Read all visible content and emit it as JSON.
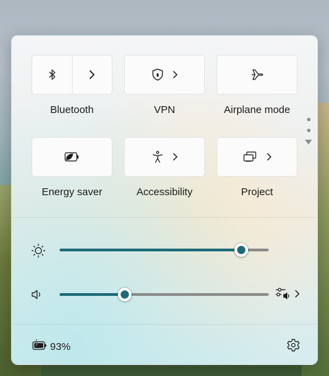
{
  "quick_settings": {
    "tiles": [
      {
        "label": "Bluetooth",
        "icon": "bluetooth-icon",
        "has_chevron": true,
        "split": true
      },
      {
        "label": "VPN",
        "icon": "vpn-shield-icon",
        "has_chevron": true
      },
      {
        "label": "Airplane mode",
        "icon": "airplane-icon",
        "has_chevron": false
      },
      {
        "label": "Energy saver",
        "icon": "energy-saver-icon",
        "has_chevron": false
      },
      {
        "label": "Accessibility",
        "icon": "accessibility-icon",
        "has_chevron": true
      },
      {
        "label": "Project",
        "icon": "project-icon",
        "has_chevron": true
      }
    ],
    "brightness": {
      "icon": "sun-icon",
      "level": 0.87
    },
    "volume": {
      "icon": "speaker-icon",
      "level": 0.31,
      "mixer_icon": "volume-mixer-icon"
    },
    "battery": {
      "icon": "battery-charging-icon",
      "percent_text": "93%"
    },
    "settings_icon": "gear-icon",
    "accent_color": "#1e6a78"
  }
}
